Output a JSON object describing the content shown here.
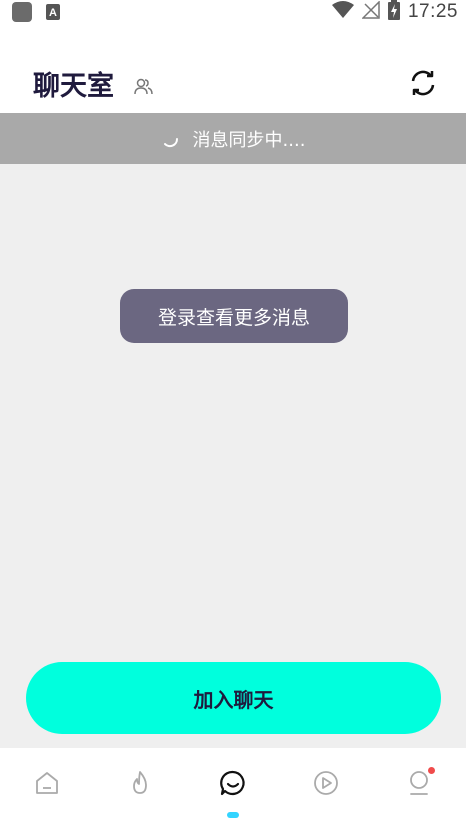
{
  "status_bar": {
    "time": "17:25",
    "icons": [
      "app-square-icon",
      "a-notification-icon",
      "wifi-icon",
      "no-signal-icon",
      "battery-charging-icon"
    ]
  },
  "header": {
    "title": "聊天室",
    "icons": [
      "people-icon",
      "refresh-icon"
    ]
  },
  "sync_banner": {
    "text": "消息同步中....",
    "icon": "spinner-icon"
  },
  "toast": {
    "text": "登录查看更多消息"
  },
  "join_button": {
    "label": "加入聊天"
  },
  "bottom_nav": {
    "items": [
      {
        "icon": "home-icon",
        "active": false
      },
      {
        "icon": "flame-icon",
        "active": false
      },
      {
        "icon": "chat-icon",
        "active": true
      },
      {
        "icon": "play-icon",
        "active": false
      },
      {
        "icon": "profile-icon",
        "active": false,
        "badge": true
      }
    ]
  },
  "colors": {
    "accent": "#00ffdd",
    "title_text": "#1f1a3d",
    "banner_bg": "#a9a9a9",
    "toast_bg": "#6b6781",
    "active_indicator": "#33d4ff",
    "badge": "#f04b4b"
  }
}
